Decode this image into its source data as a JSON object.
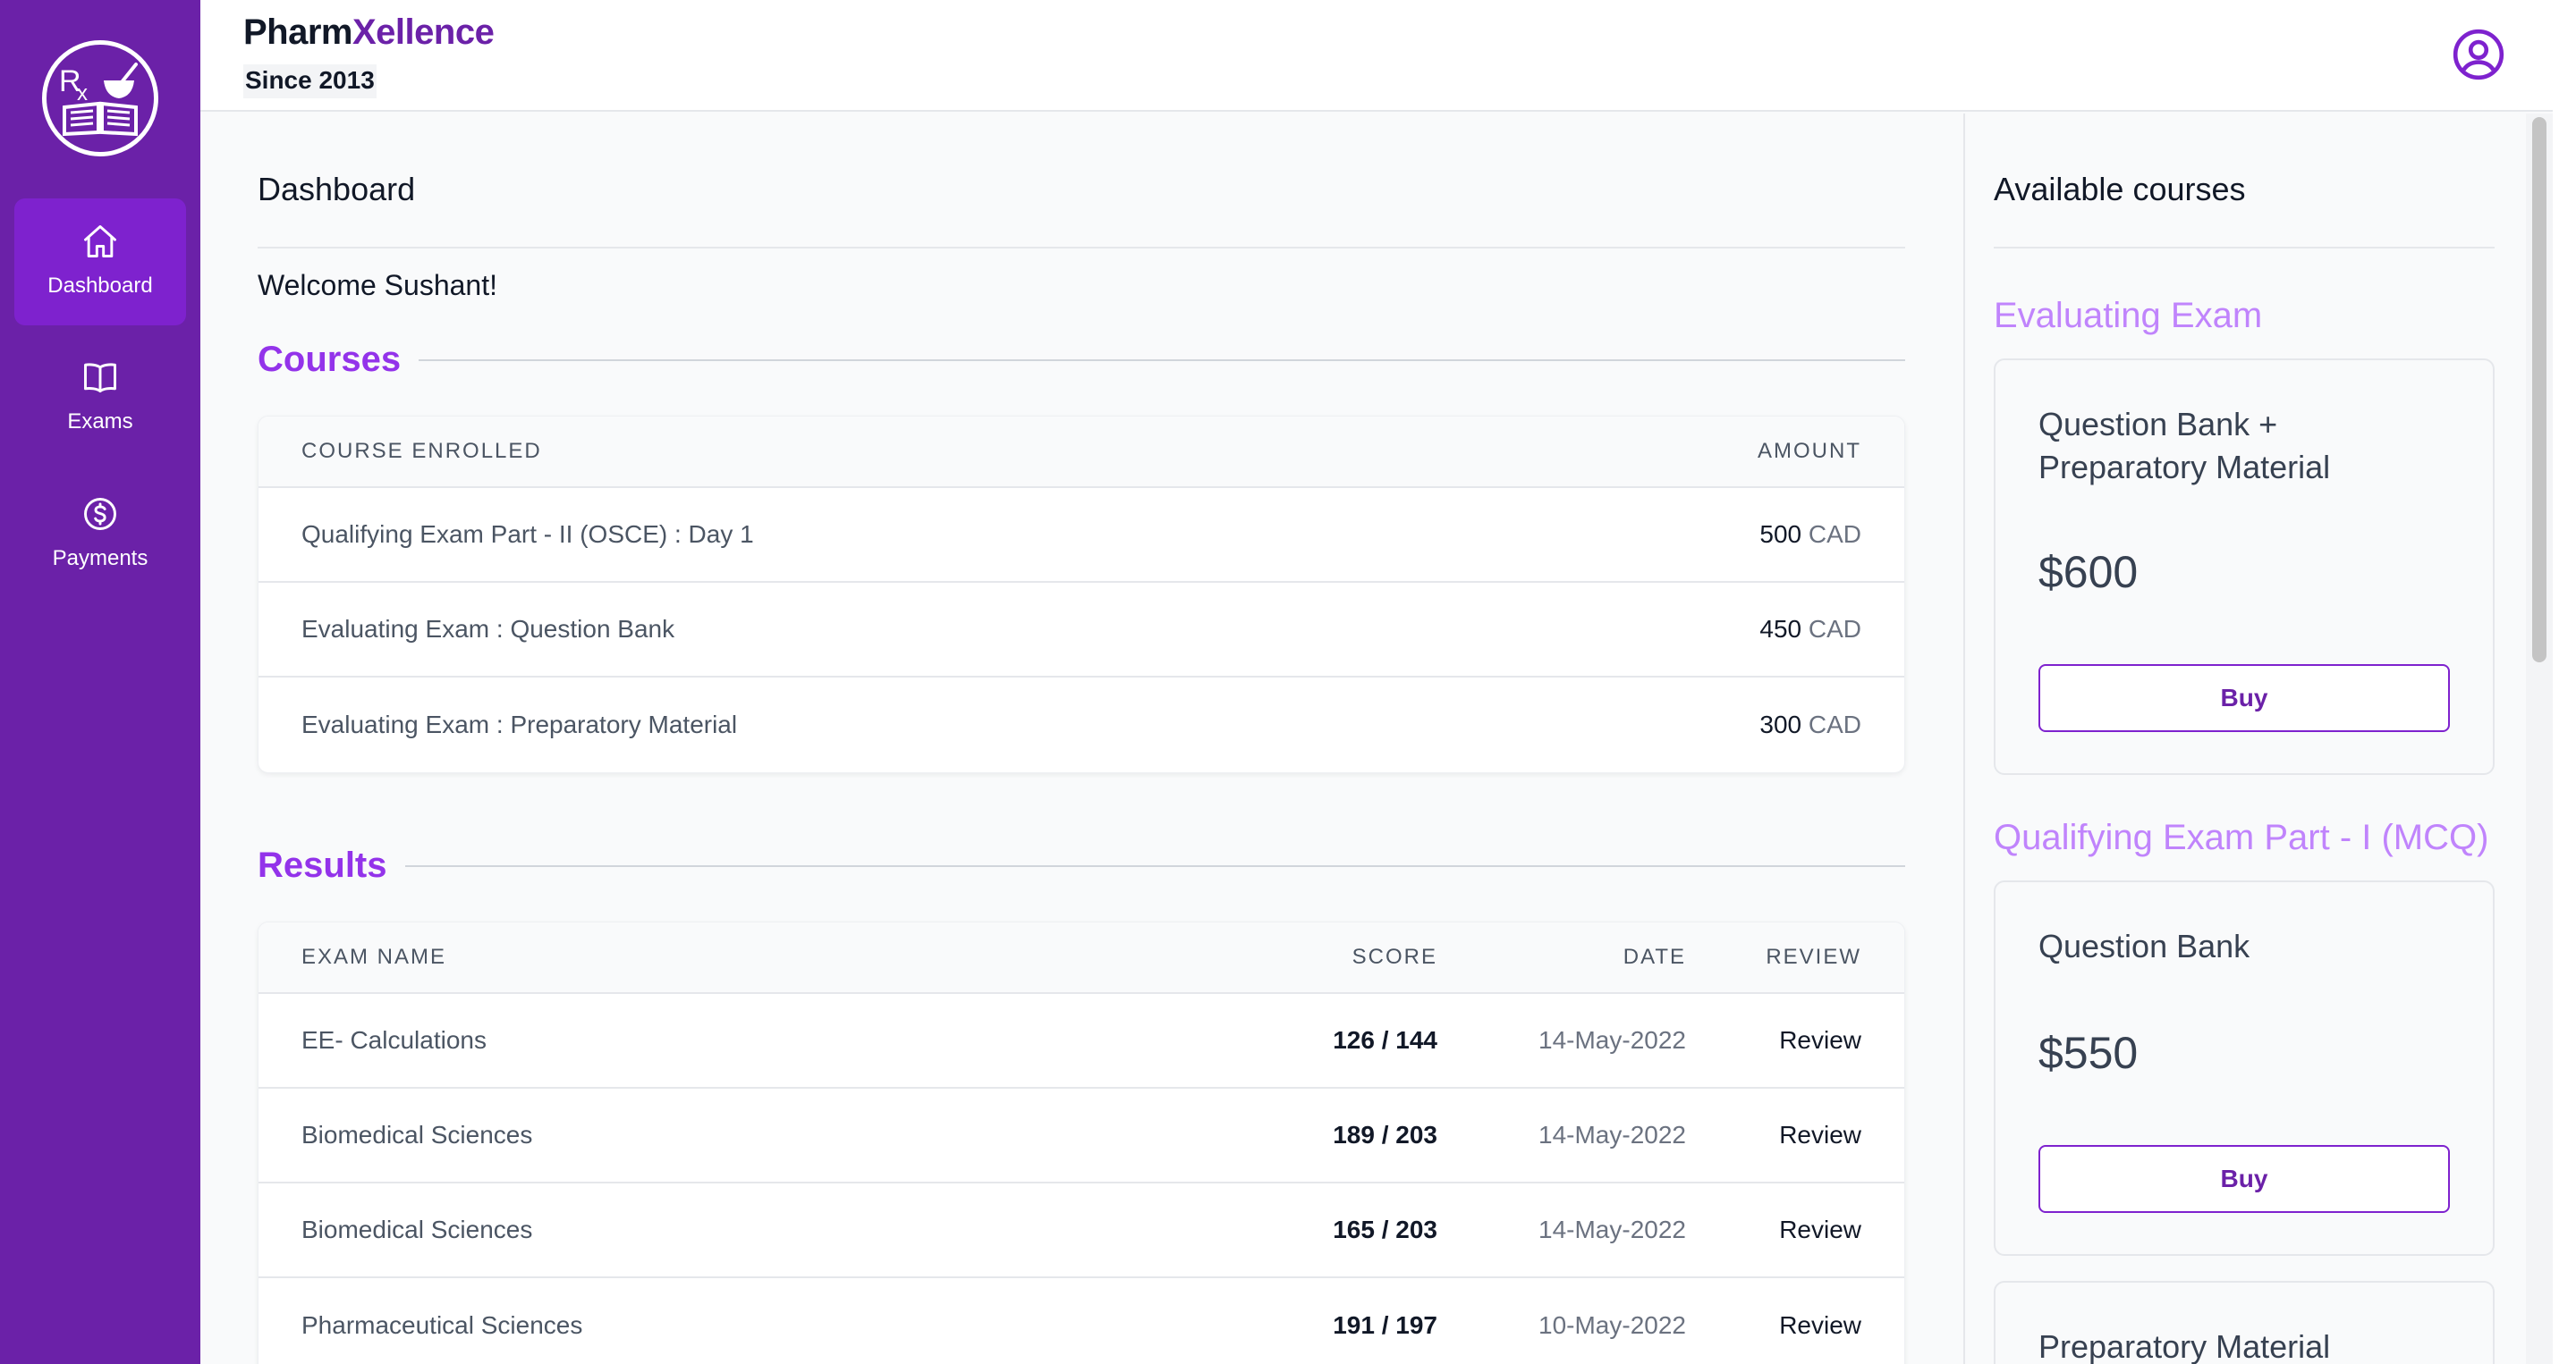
{
  "header": {
    "brand_part1": "Pharm",
    "brand_part2": "Xellence",
    "tagline": "Since 2013"
  },
  "sidebar": {
    "items": [
      {
        "label": "Dashboard",
        "icon": "home-icon",
        "active": true
      },
      {
        "label": "Exams",
        "icon": "book-icon",
        "active": false
      },
      {
        "label": "Payments",
        "icon": "dollar-icon",
        "active": false
      }
    ]
  },
  "main": {
    "title": "Dashboard",
    "welcome": "Welcome Sushant!",
    "courses": {
      "title": "Courses",
      "columns": [
        "COURSE ENROLLED",
        "AMOUNT"
      ],
      "rows": [
        {
          "name": "Qualifying Exam Part - II (OSCE) : Day 1",
          "amount": "500",
          "currency": "CAD"
        },
        {
          "name": "Evaluating Exam : Question Bank",
          "amount": "450",
          "currency": "CAD"
        },
        {
          "name": "Evaluating Exam : Preparatory Material",
          "amount": "300",
          "currency": "CAD"
        }
      ]
    },
    "results": {
      "title": "Results",
      "columns": [
        "EXAM NAME",
        "SCORE",
        "DATE",
        "REVIEW"
      ],
      "rows": [
        {
          "name": "EE- Calculations",
          "score": "126 / 144",
          "date": "14-May-2022",
          "review": "Review"
        },
        {
          "name": "Biomedical Sciences",
          "score": "189 / 203",
          "date": "14-May-2022",
          "review": "Review"
        },
        {
          "name": "Biomedical Sciences",
          "score": "165 / 203",
          "date": "14-May-2022",
          "review": "Review"
        },
        {
          "name": "Pharmaceutical Sciences",
          "score": "191 / 197",
          "date": "10-May-2022",
          "review": "Review"
        }
      ]
    }
  },
  "right": {
    "title": "Available courses",
    "groups": [
      {
        "category": "Evaluating Exam",
        "course": "Question Bank + Preparatory Material",
        "price": "$600",
        "button": "Buy"
      },
      {
        "category": "Qualifying Exam Part - I (MCQ)",
        "course": "Question Bank",
        "price": "$550",
        "button": "Buy"
      },
      {
        "category": "",
        "course": "Preparatory Material",
        "price": "",
        "button": ""
      }
    ]
  },
  "colors": {
    "sidebar": "#6b21a8",
    "sidebar_active": "#7e22ce",
    "accent": "#9333ea",
    "accent_light": "#c084fc"
  }
}
